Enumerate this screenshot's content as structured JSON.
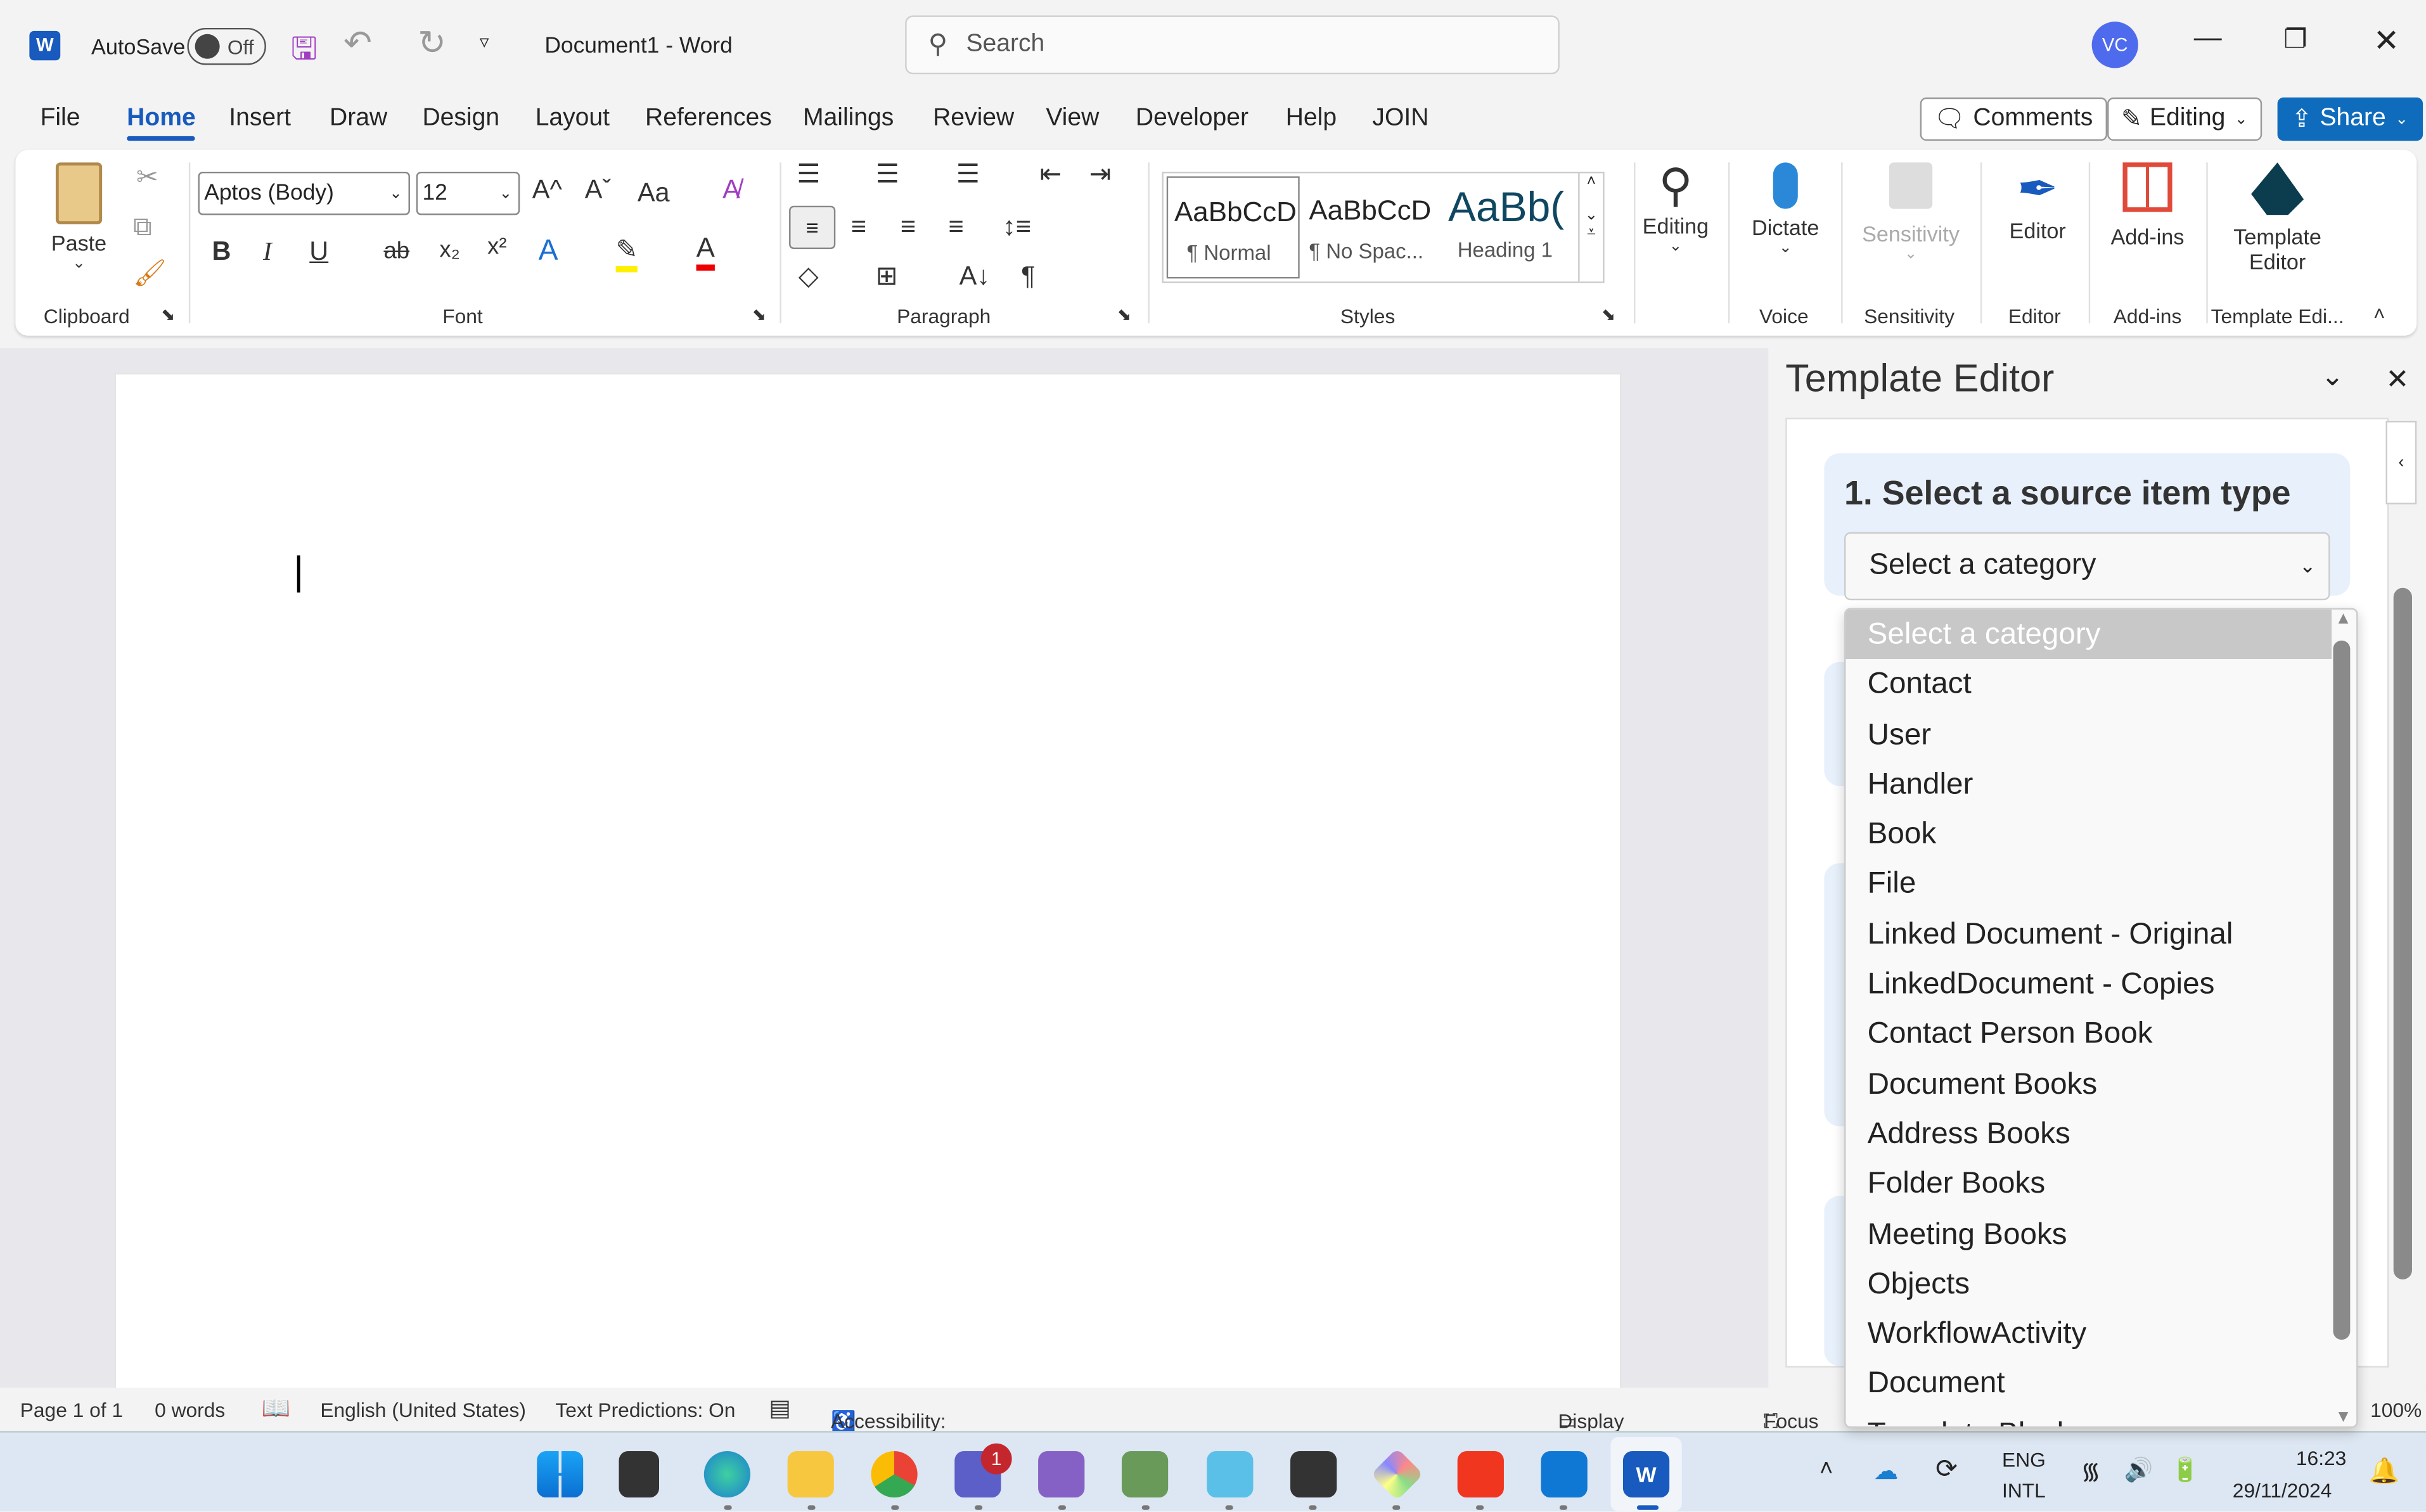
{
  "titlebar": {
    "autosave": "AutoSave",
    "toggle": "Off",
    "doc_title": "Document1  -  Word",
    "search_placeholder": "Search",
    "avatar": "VC"
  },
  "menu": {
    "tabs": [
      "File",
      "Home",
      "Insert",
      "Draw",
      "Design",
      "Layout",
      "References",
      "Mailings",
      "Review",
      "View",
      "Developer",
      "Help",
      "JOIN"
    ],
    "active": "Home",
    "comments": "Comments",
    "editing": "Editing",
    "share": "Share"
  },
  "ribbon": {
    "clipboard": {
      "paste": "Paste",
      "label": "Clipboard"
    },
    "font": {
      "name": "Aptos (Body)",
      "size": "12",
      "label": "Font",
      "bold": "B",
      "italic": "I",
      "underline": "U",
      "strike": "ab",
      "sub": "x₂",
      "sup": "x²",
      "case": "Aa",
      "grow": "A^",
      "shrink": "Aˇ"
    },
    "paragraph": {
      "label": "Paragraph"
    },
    "styles": {
      "label": "Styles",
      "items": [
        {
          "preview": "AaBbCcD",
          "name": "¶ Normal"
        },
        {
          "preview": "AaBbCcD",
          "name": "¶ No Spac..."
        },
        {
          "preview": "AaBb(",
          "name": "Heading 1"
        }
      ]
    },
    "editing": {
      "label": "Editing"
    },
    "voice": {
      "button": "Dictate",
      "label": "Voice"
    },
    "sensitivity": {
      "button": "Sensitivity",
      "label": "Sensitivity"
    },
    "editor": {
      "button": "Editor",
      "label": "Editor"
    },
    "addins": {
      "button": "Add-ins",
      "label": "Add-ins"
    },
    "template": {
      "button1": "Template",
      "button2": "Editor",
      "label": "Template Edi..."
    }
  },
  "pane": {
    "title": "Template Editor",
    "step1": "1. Select a source item type",
    "select_value": "Select a category",
    "options": [
      "Select a category",
      "Contact",
      "User",
      "Handler",
      "Book",
      "File",
      "Linked Document - Original",
      "LinkedDocument - Copies",
      "Contact Person Book",
      "Document Books",
      "Address Books",
      "Folder Books",
      "Meeting Books",
      "Objects",
      "WorkflowActivity",
      "Document",
      "Template Block"
    ]
  },
  "status": {
    "page": "Page 1 of 1",
    "words": "0 words",
    "language": "English (United States)",
    "predictions": "Text Predictions: On",
    "accessibility": "Accessibility: Good to go",
    "display": "Display Settings",
    "focus": "Focus",
    "zoom": "100%"
  },
  "taskbar": {
    "lang1": "ENG",
    "lang2": "INTL",
    "time": "16:23",
    "date": "29/11/2024",
    "teams_badge": "1"
  },
  "colors": {
    "word_blue": "#185abd",
    "share": "#0f6cbd",
    "template_card": "#e8f1fb"
  }
}
